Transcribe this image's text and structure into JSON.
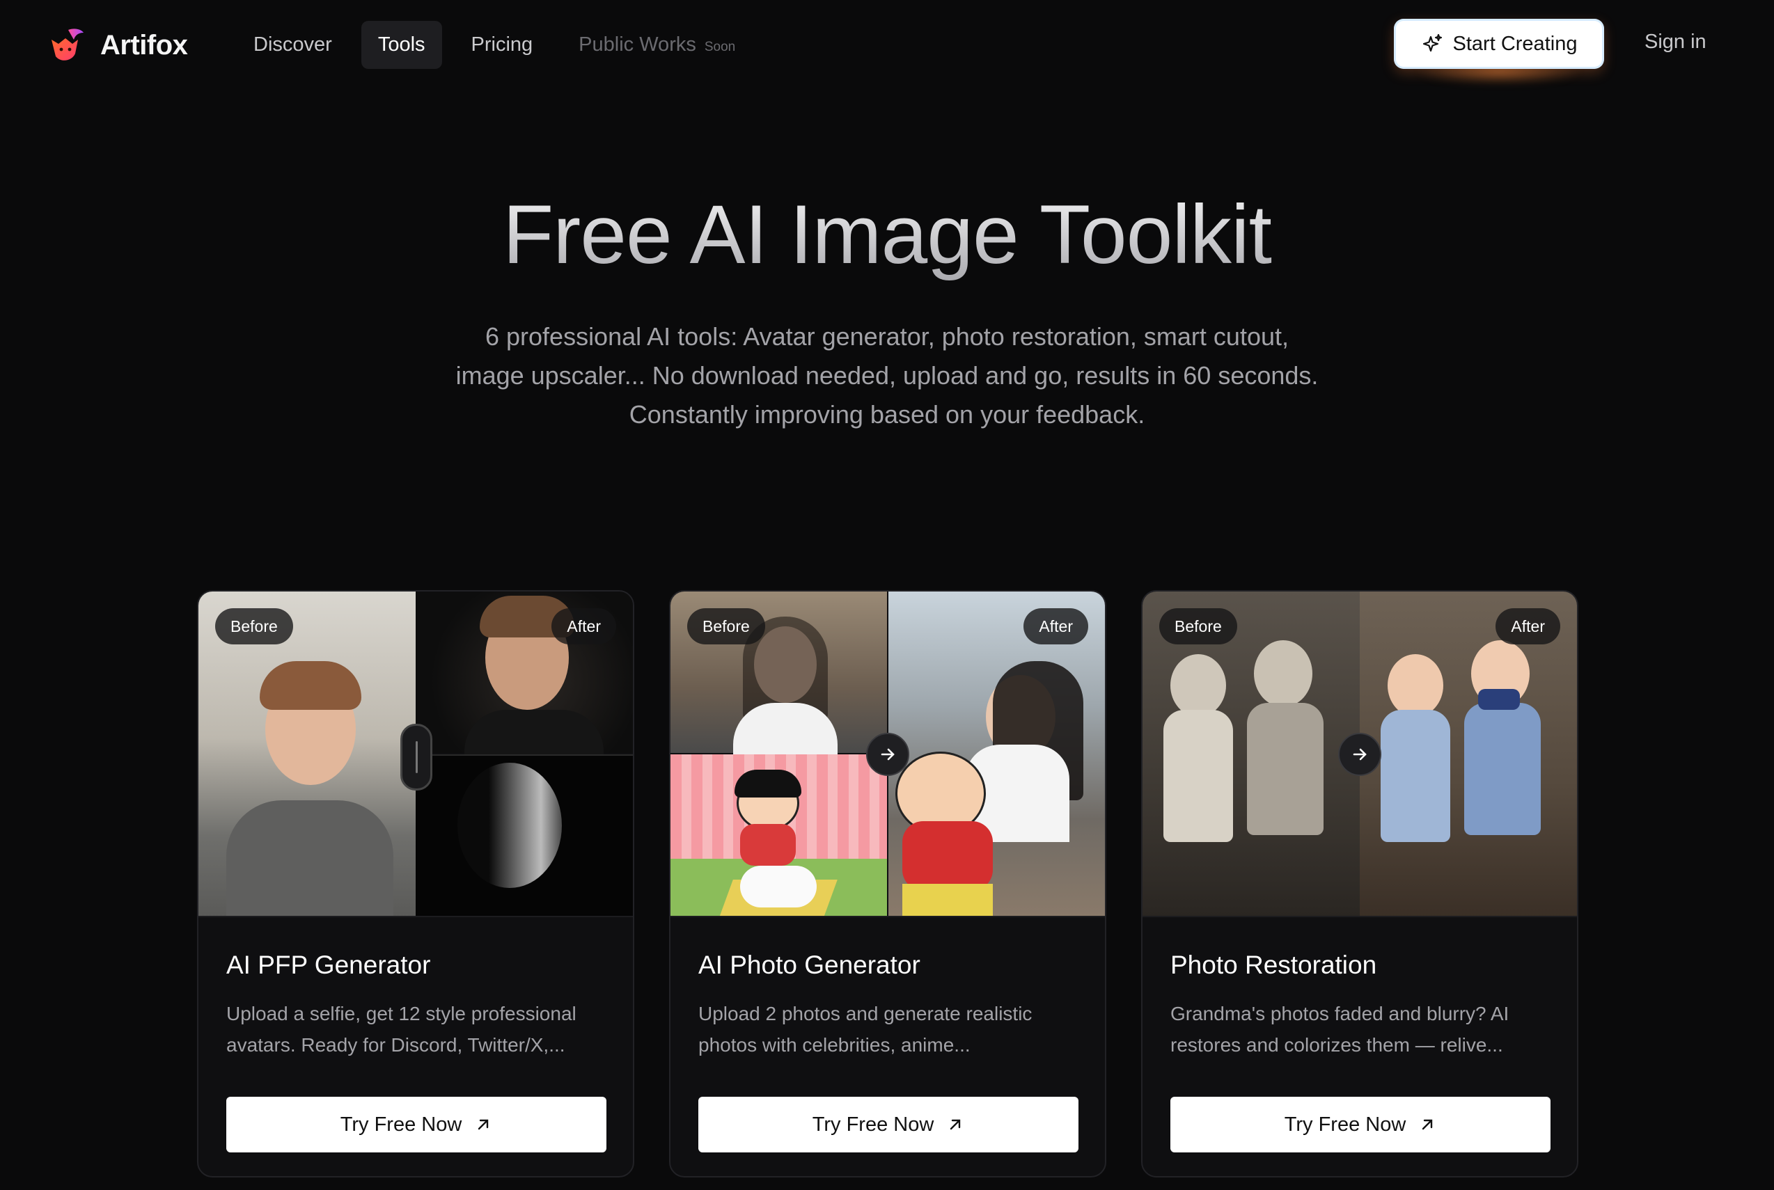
{
  "brand": {
    "name": "Artifox",
    "logo_icon": "fox-logo-icon"
  },
  "nav": {
    "links": [
      {
        "label": "Discover",
        "active": false
      },
      {
        "label": "Tools",
        "active": true
      },
      {
        "label": "Pricing",
        "active": false
      }
    ],
    "public_works": {
      "label": "Public Works",
      "tag": "Soon"
    },
    "cta": {
      "label": "Start Creating",
      "icon": "sparkle-icon"
    },
    "signin": "Sign in"
  },
  "hero": {
    "title": "Free AI Image Toolkit",
    "subtitle_lines": [
      "6 professional AI tools: Avatar generator, photo restoration, smart cutout,",
      "image upscaler... No download needed, upload and go, results in 60 seconds.",
      "Constantly improving based on your feedback."
    ]
  },
  "cards": [
    {
      "before": "Before",
      "after": "After",
      "title": "AI PFP Generator",
      "desc_lines": [
        "Upload a selfie, get 12 style professional",
        "avatars. Ready for Discord, Twitter/X,..."
      ],
      "button": "Try Free Now"
    },
    {
      "before": "Before",
      "after": "After",
      "title": "AI Photo Generator",
      "desc_lines": [
        "Upload 2 photos and generate realistic",
        "photos with celebrities, anime..."
      ],
      "button": "Try Free Now"
    },
    {
      "before": "Before",
      "after": "After",
      "title": "Photo Restoration",
      "desc_lines": [
        "Grandma's photos faded and blurry? AI",
        "restores and colorizes them — relive..."
      ],
      "button": "Try Free Now"
    }
  ],
  "colors": {
    "background": "#0a0a0b",
    "card_border": "#222226",
    "accent_glow": "#ff8c3c",
    "muted_text": "#a3a3a8"
  }
}
